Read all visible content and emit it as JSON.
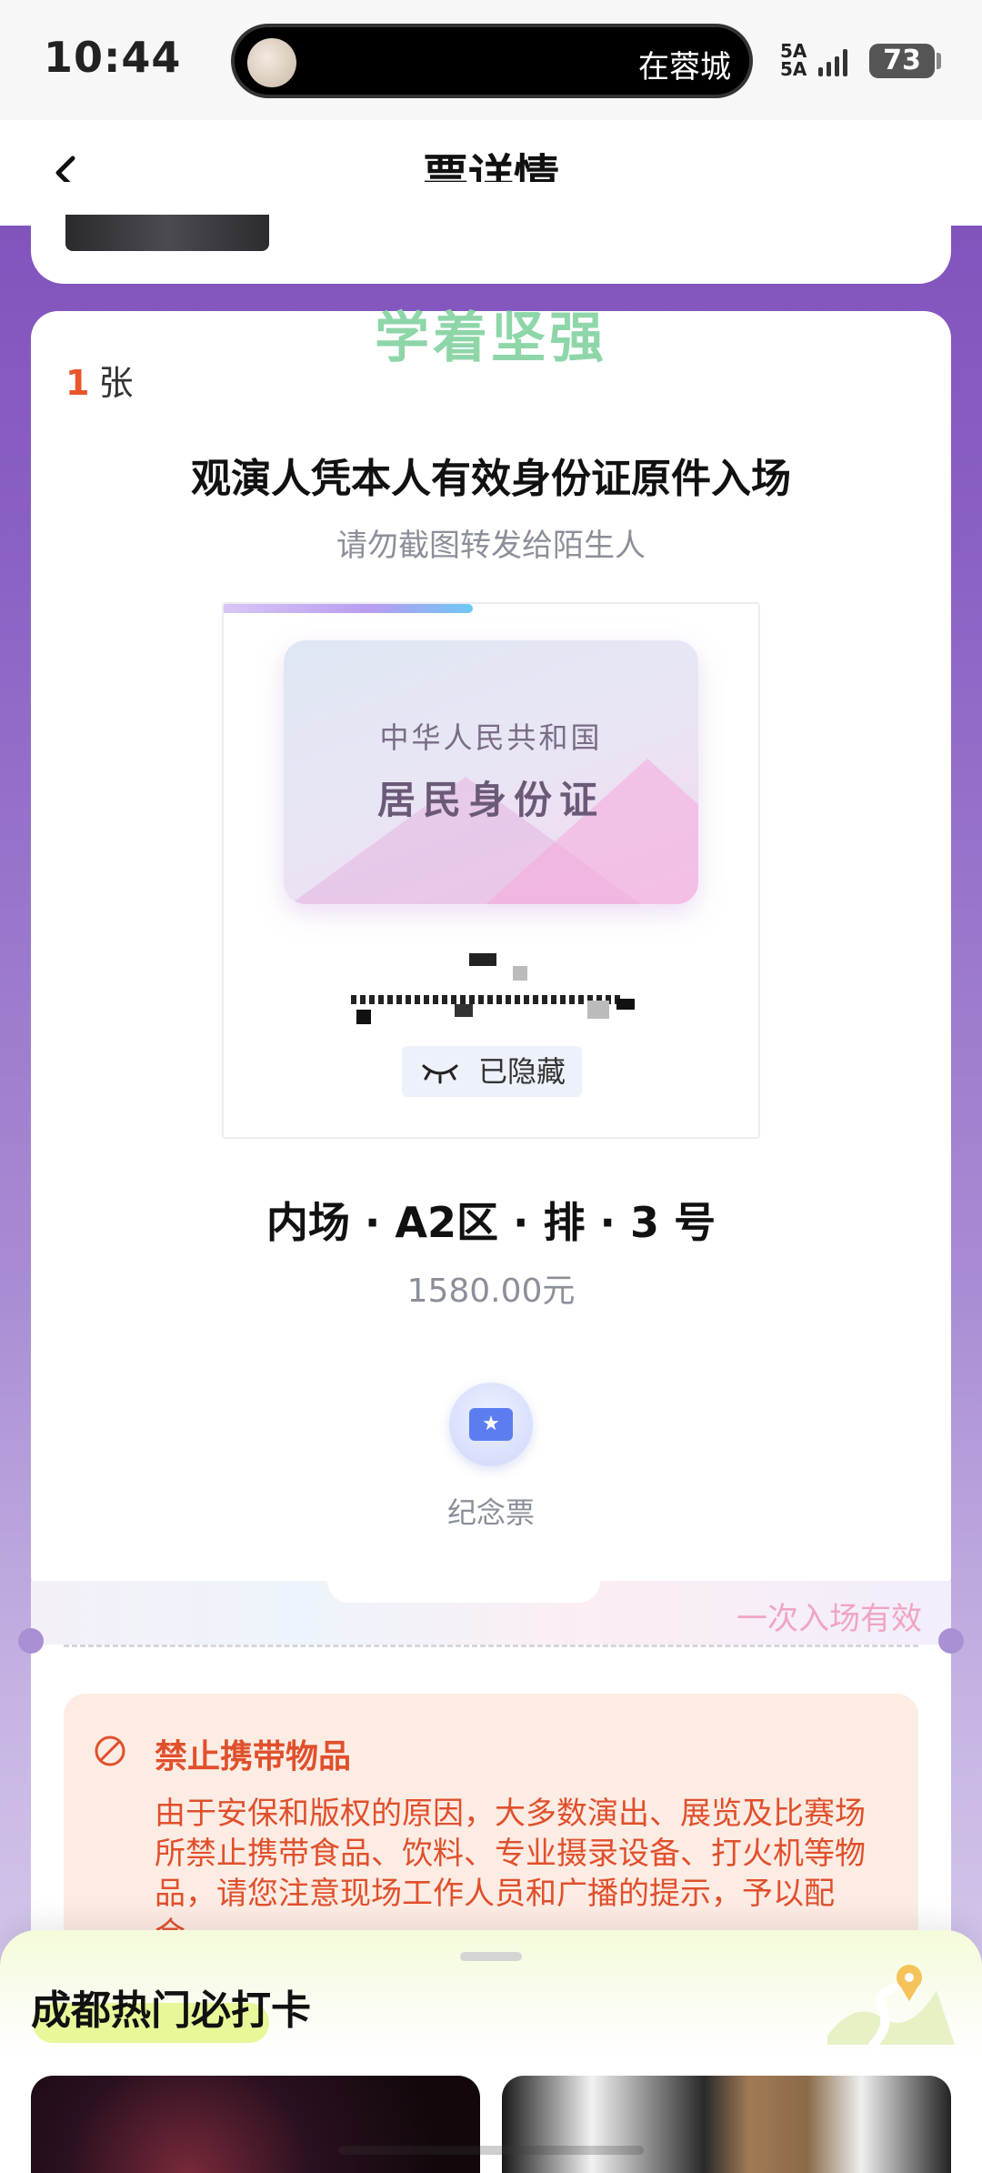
{
  "status_bar": {
    "time": "10:44",
    "island_text": "在蓉城",
    "network_top": "5A",
    "network_bottom": "5A",
    "battery": "73"
  },
  "nav": {
    "title": "票详情",
    "back_icon": "chevron-left-icon"
  },
  "ticket": {
    "motto": "学着坚强",
    "count_num": "1",
    "count_unit": "张",
    "notice_title": "观演人凭本人有效身份证原件入场",
    "notice_sub": "请勿截图转发给陌生人",
    "id_card": {
      "line1": "中华人民共和国",
      "line2": "居民身份证",
      "hidden_label": "已隐藏",
      "hidden_icon": "closed-eye-icon"
    },
    "seat": "内场 · A2区 · 排 · 3 号",
    "price": "1580.00元",
    "souvenir_icon": "ticket-star-icon",
    "souvenir_label": "纪念票",
    "once_valid": "一次入场有效"
  },
  "warning": {
    "icon": "ban-icon",
    "title": "禁止携带物品",
    "body": "由于安保和版权的原因，大多数演出、展览及比赛场所禁止携带食品、饮料、专业摄录设备、打火机等物品，请您注意现场工作人员和广播的提示，予以配合。"
  },
  "sheet": {
    "title": "成都热门必打卡",
    "map_icon": "map-pin-icon"
  },
  "colors": {
    "accent_orange": "#e8562a",
    "warning_red": "#e0502c",
    "purple_bg": "#7a4cb8",
    "motto_green": "#8ed6a8"
  }
}
